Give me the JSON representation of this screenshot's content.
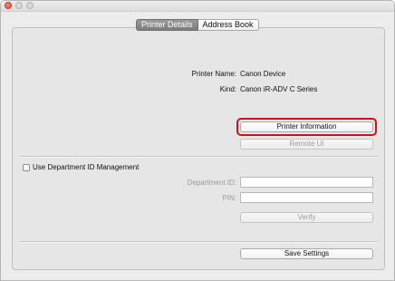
{
  "tabs": [
    {
      "label": "Printer Details",
      "active": true
    },
    {
      "label": "Address Book",
      "active": false
    }
  ],
  "printer": {
    "name_label": "Printer Name:",
    "name_value": "Canon Device",
    "kind_label": "Kind:",
    "kind_value": "Canon iR-ADV C Series"
  },
  "buttons": {
    "printer_information": "Printer Information",
    "remote_ui": "Remote UI",
    "verify": "Verify",
    "save_settings": "Save Settings"
  },
  "department": {
    "checkbox_label": "Use Department ID Management",
    "checked": false,
    "id_label": "Department ID:",
    "id_value": "",
    "pin_label": "PIN:",
    "pin_value": ""
  },
  "colors": {
    "highlight": "#d0111d",
    "active_tab": "#8a8a8a"
  }
}
